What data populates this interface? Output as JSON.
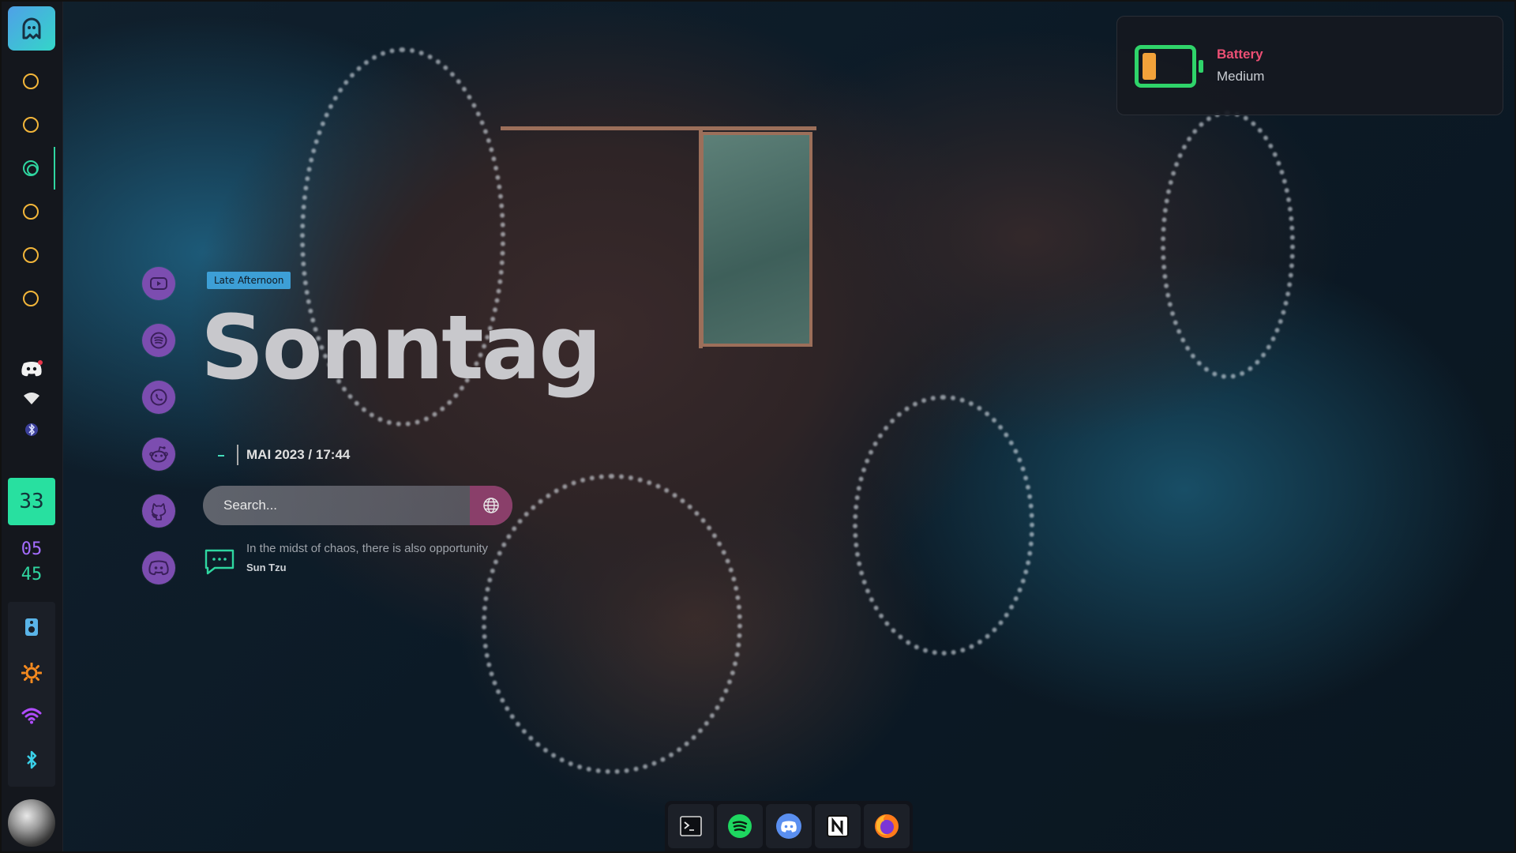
{
  "colors": {
    "accent_green": "#2fd6a0",
    "workspace_yellow": "#f3b63a",
    "launcher_purple": "#7c4db0",
    "battery_title": "#ec4f74",
    "battery_green": "#2fd46a",
    "battery_fill": "#f2a23a"
  },
  "sidebar": {
    "launcher_icon": "ghost-icon",
    "workspaces": [
      {
        "active": false
      },
      {
        "active": false
      },
      {
        "active": true
      },
      {
        "active": false
      },
      {
        "active": false
      },
      {
        "active": false
      }
    ],
    "tray_icons": [
      "discord-icon",
      "wifi-icon",
      "bluetooth-icon"
    ],
    "day_number": "33",
    "time_hours": "05",
    "time_minutes": "45",
    "controls": [
      "speaker-icon",
      "brightness-icon",
      "wifi-icon",
      "bluetooth-icon"
    ]
  },
  "quick_launch": [
    "youtube-icon",
    "spotify-icon",
    "whatsapp-icon",
    "reddit-icon",
    "github-icon",
    "discord-icon"
  ],
  "greeting": {
    "period": "Late Afternoon",
    "day": "Sonntag",
    "datetime": "MAI 2023 / 17:44"
  },
  "search": {
    "placeholder": "Search..."
  },
  "quote": {
    "text": "In the midst of chaos, there is also opportunity",
    "author": "Sun Tzu"
  },
  "notification": {
    "title": "Battery",
    "body": "Medium",
    "level": 0.3
  },
  "dock": [
    "terminal-icon",
    "spotify-icon",
    "discord-icon",
    "notion-icon",
    "firefox-icon"
  ]
}
